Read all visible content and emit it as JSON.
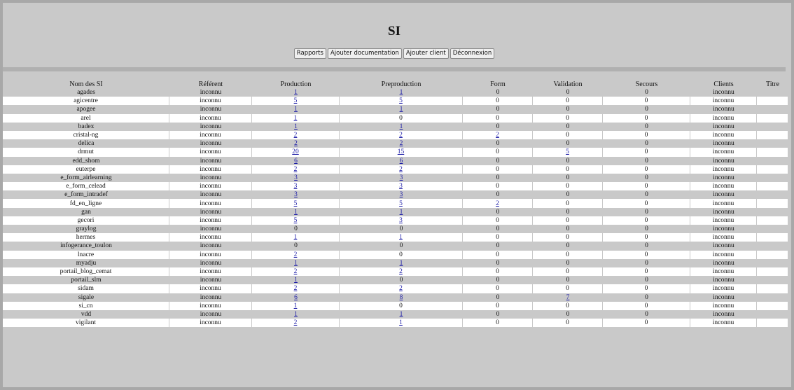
{
  "page": {
    "title": "SI"
  },
  "toolbar": {
    "buttons": [
      "Rapports",
      "Ajouter documentation",
      "Ajouter client",
      "Déconnexion"
    ]
  },
  "table": {
    "columns": [
      "Nom des SI",
      "Référent",
      "Production",
      "Preproduction",
      "Form",
      "Validation",
      "Secours",
      "Clients",
      "Titre"
    ],
    "rows": [
      {
        "name": "agades",
        "ref": "inconnu",
        "prod": "1",
        "preprod": "1",
        "form": "0",
        "valid": "0",
        "secours": "0",
        "clients": "inconnu",
        "titre": ""
      },
      {
        "name": "agicentre",
        "ref": "inconnu",
        "prod": "5",
        "preprod": "5",
        "form": "0",
        "valid": "0",
        "secours": "0",
        "clients": "inconnu",
        "titre": ""
      },
      {
        "name": "apogee",
        "ref": "inconnu",
        "prod": "1",
        "preprod": "1",
        "form": "0",
        "valid": "0",
        "secours": "0",
        "clients": "inconnu",
        "titre": ""
      },
      {
        "name": "arel",
        "ref": "inconnu",
        "prod": "1",
        "preprod": "0",
        "form": "0",
        "valid": "0",
        "secours": "0",
        "clients": "inconnu",
        "titre": ""
      },
      {
        "name": "badex",
        "ref": "inconnu",
        "prod": "1",
        "preprod": "1",
        "form": "0",
        "valid": "0",
        "secours": "0",
        "clients": "inconnu",
        "titre": ""
      },
      {
        "name": "cristal-ng",
        "ref": "inconnu",
        "prod": "2",
        "preprod": "2",
        "form": "2",
        "valid": "0",
        "secours": "0",
        "clients": "inconnu",
        "titre": ""
      },
      {
        "name": "delica",
        "ref": "inconnu",
        "prod": "2",
        "preprod": "2",
        "form": "0",
        "valid": "0",
        "secours": "0",
        "clients": "inconnu",
        "titre": ""
      },
      {
        "name": "drmut",
        "ref": "inconnu",
        "prod": "20",
        "preprod": "15",
        "form": "0",
        "valid": "5",
        "secours": "0",
        "clients": "inconnu",
        "titre": ""
      },
      {
        "name": "edd_shom",
        "ref": "inconnu",
        "prod": "6",
        "preprod": "6",
        "form": "0",
        "valid": "0",
        "secours": "0",
        "clients": "inconnu",
        "titre": ""
      },
      {
        "name": "euterpe",
        "ref": "inconnu",
        "prod": "2",
        "preprod": "2",
        "form": "0",
        "valid": "0",
        "secours": "0",
        "clients": "inconnu",
        "titre": ""
      },
      {
        "name": "e_form_airlearning",
        "ref": "inconnu",
        "prod": "3",
        "preprod": "3",
        "form": "0",
        "valid": "0",
        "secours": "0",
        "clients": "inconnu",
        "titre": ""
      },
      {
        "name": "e_form_celead",
        "ref": "inconnu",
        "prod": "3",
        "preprod": "3",
        "form": "0",
        "valid": "0",
        "secours": "0",
        "clients": "inconnu",
        "titre": ""
      },
      {
        "name": "e_form_intradef",
        "ref": "inconnu",
        "prod": "3",
        "preprod": "3",
        "form": "0",
        "valid": "0",
        "secours": "0",
        "clients": "inconnu",
        "titre": ""
      },
      {
        "name": "fd_en_ligne",
        "ref": "inconnu",
        "prod": "5",
        "preprod": "5",
        "form": "2",
        "valid": "0",
        "secours": "0",
        "clients": "inconnu",
        "titre": ""
      },
      {
        "name": "gan",
        "ref": "inconnu",
        "prod": "1",
        "preprod": "1",
        "form": "0",
        "valid": "0",
        "secours": "0",
        "clients": "inconnu",
        "titre": ""
      },
      {
        "name": "gecori",
        "ref": "inconnu",
        "prod": "5",
        "preprod": "3",
        "form": "0",
        "valid": "0",
        "secours": "0",
        "clients": "inconnu",
        "titre": ""
      },
      {
        "name": "graylog",
        "ref": "inconnu",
        "prod": "0",
        "preprod": "0",
        "form": "0",
        "valid": "0",
        "secours": "0",
        "clients": "inconnu",
        "titre": ""
      },
      {
        "name": "hermes",
        "ref": "inconnu",
        "prod": "1",
        "preprod": "1",
        "form": "0",
        "valid": "0",
        "secours": "0",
        "clients": "inconnu",
        "titre": ""
      },
      {
        "name": "infogerance_toulon",
        "ref": "inconnu",
        "prod": "0",
        "preprod": "0",
        "form": "0",
        "valid": "0",
        "secours": "0",
        "clients": "inconnu",
        "titre": ""
      },
      {
        "name": "lnacre",
        "ref": "inconnu",
        "prod": "2",
        "preprod": "0",
        "form": "0",
        "valid": "0",
        "secours": "0",
        "clients": "inconnu",
        "titre": ""
      },
      {
        "name": "myadju",
        "ref": "inconnu",
        "prod": "1",
        "preprod": "1",
        "form": "0",
        "valid": "0",
        "secours": "0",
        "clients": "inconnu",
        "titre": ""
      },
      {
        "name": "portail_blog_cemat",
        "ref": "inconnu",
        "prod": "2",
        "preprod": "2",
        "form": "0",
        "valid": "0",
        "secours": "0",
        "clients": "inconnu",
        "titre": ""
      },
      {
        "name": "portail_slm",
        "ref": "inconnu",
        "prod": "1",
        "preprod": "0",
        "form": "0",
        "valid": "0",
        "secours": "0",
        "clients": "inconnu",
        "titre": ""
      },
      {
        "name": "sidam",
        "ref": "inconnu",
        "prod": "2",
        "preprod": "2",
        "form": "0",
        "valid": "0",
        "secours": "0",
        "clients": "inconnu",
        "titre": ""
      },
      {
        "name": "sigale",
        "ref": "inconnu",
        "prod": "6",
        "preprod": "8",
        "form": "0",
        "valid": "7",
        "secours": "0",
        "clients": "inconnu",
        "titre": ""
      },
      {
        "name": "si_cn",
        "ref": "inconnu",
        "prod": "1",
        "preprod": "0",
        "form": "0",
        "valid": "0",
        "secours": "0",
        "clients": "inconnu",
        "titre": ""
      },
      {
        "name": "vdd",
        "ref": "inconnu",
        "prod": "1",
        "preprod": "1",
        "form": "0",
        "valid": "0",
        "secours": "0",
        "clients": "inconnu",
        "titre": ""
      },
      {
        "name": "vigilant",
        "ref": "inconnu",
        "prod": "2",
        "preprod": "1",
        "form": "0",
        "valid": "0",
        "secours": "0",
        "clients": "inconnu",
        "titre": ""
      }
    ]
  }
}
